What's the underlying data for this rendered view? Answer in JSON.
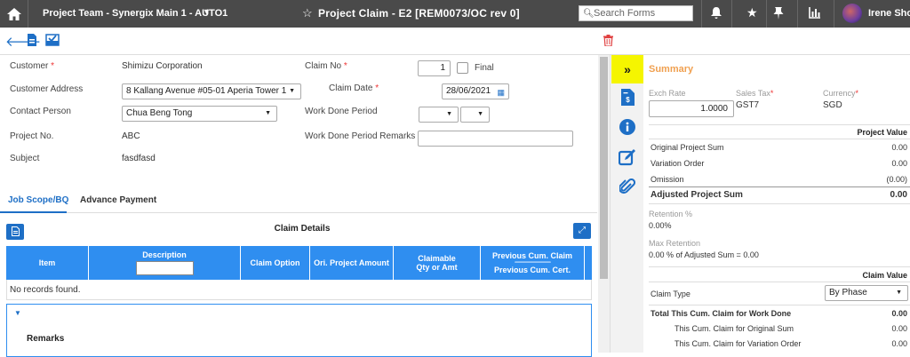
{
  "topbar": {
    "project": "Project Team - Synergix Main 1 - AUTO1",
    "title": "Project Claim - E2 [REM0073/OC rev 0]",
    "search_placeholder": "Search Forms",
    "user": "Irene Short"
  },
  "form": {
    "customer_label": "Customer",
    "customer": "Shimizu Corporation",
    "address_label": "Customer Address",
    "address": "8 Kallang Avenue #05-01 Aperia Tower 1",
    "contact_label": "Contact Person",
    "contact": "Chua Beng Tong",
    "projno_label": "Project No.",
    "projno": "ABC",
    "subject_label": "Subject",
    "subject": "fasdfasd",
    "claimno_label": "Claim No",
    "claimno": "1",
    "final_label": "Final",
    "claimdate_label": "Claim Date",
    "claimdate": "28/06/2021",
    "wdp_label": "Work Done Period",
    "wdp_remarks_label": "Work Done Period Remarks"
  },
  "tabs": [
    "Job Scope/BQ",
    "Advance Payment"
  ],
  "claim_details": {
    "title": "Claim Details",
    "columns": [
      "Item",
      "Description",
      "Claim Option",
      "Ori. Project Amount",
      "Claimable Qty or Amt",
      "Previous Cum. Claim",
      "Previous Cum. Cert."
    ],
    "empty_text": "No records found.",
    "remarks_label": "Remarks"
  },
  "summary": {
    "title": "Summary",
    "exch_rate_label": "Exch Rate",
    "exch_rate": "1.0000",
    "sales_tax_label": "Sales Tax",
    "sales_tax": "GST7",
    "currency_label": "Currency",
    "currency": "SGD",
    "project_value_head": "Project Value",
    "original_sum_label": "Original Project Sum",
    "original_sum": "0.00",
    "variation_label": "Variation Order",
    "variation": "0.00",
    "omission_label": "Omission",
    "omission": "(0.00)",
    "adjusted_label": "Adjusted Project Sum",
    "adjusted": "0.00",
    "retention_label": "Retention %",
    "retention": "0.00%",
    "max_retention_label": "Max Retention",
    "max_retention": "0.00 % of Adjusted Sum = 0.00",
    "claim_value_head": "Claim Value",
    "claim_type_label": "Claim Type",
    "claim_type": "By Phase",
    "total_label": "Total This Cum. Claim for Work Done",
    "total": "0.00",
    "orig_cum_label": "This Cum. Claim for Original Sum",
    "orig_cum": "0.00",
    "var_cum_label": "This Cum. Claim for Variation Order",
    "var_cum": "0.00"
  }
}
